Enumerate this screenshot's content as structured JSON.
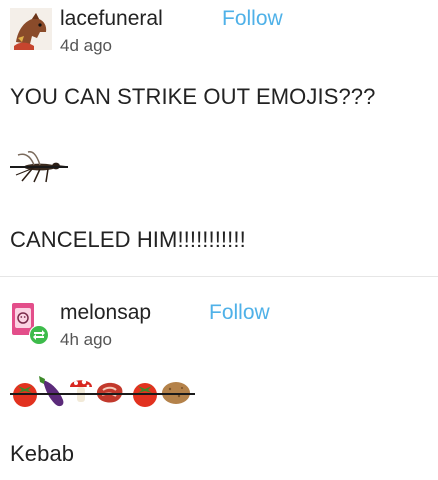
{
  "posts": [
    {
      "username": "lacefuneral",
      "follow_label": "Follow",
      "timestamp": "4d ago",
      "text_lines": [
        "YOU CAN STRIKE OUT EMOJIS???",
        "CANCELED HIM!!!!!!!!!!!"
      ],
      "emojis": [
        "mosquito-icon"
      ],
      "avatar_icon": "horse-avatar-icon"
    },
    {
      "username": "melonsap",
      "follow_label": "Follow",
      "timestamp": "4h ago",
      "text_lines": [
        "Kebab"
      ],
      "emojis": [
        "tomato-icon",
        "eggplant-icon",
        "mushroom-icon",
        "meat-icon",
        "tomato-icon",
        "potato-icon"
      ],
      "avatar_icon": "juice-box-avatar-icon",
      "reblog_badge_icon": "reblog-icon"
    }
  ],
  "colors": {
    "follow": "#4fb1e8",
    "text": "#222222",
    "timestamp": "#555555",
    "divider": "#e6e6e6",
    "reblog_badge": "#3dbb4b"
  }
}
